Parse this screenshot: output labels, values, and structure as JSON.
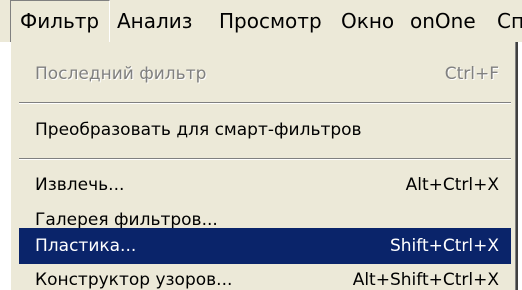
{
  "menubar": {
    "items": [
      {
        "label": "Фильтр"
      },
      {
        "label": "Анализ"
      },
      {
        "label": "Просмотр"
      },
      {
        "label": "Окно"
      },
      {
        "label": "onOne"
      },
      {
        "label": "Спр"
      }
    ],
    "active_index": 0
  },
  "dropdown": {
    "items": [
      {
        "label": "Последний фильтр",
        "shortcut": "Ctrl+F",
        "enabled": false
      },
      {
        "label": "Преобразовать для смарт-фильтров",
        "shortcut": "",
        "enabled": true
      },
      {
        "label": "Извлечь...",
        "shortcut": "Alt+Ctrl+X",
        "enabled": true
      },
      {
        "label": "Галерея фильтров...",
        "shortcut": "",
        "enabled": true
      },
      {
        "label": "Пластика...",
        "shortcut": "Shift+Ctrl+X",
        "enabled": true,
        "highlighted": true
      },
      {
        "label": "Конструктор узоров...",
        "shortcut": "Alt+Shift+Ctrl+X",
        "enabled": true
      }
    ]
  },
  "colors": {
    "menu_background": "#ece9d8",
    "highlight_background": "#0a246a",
    "highlight_text": "#ffffff",
    "disabled_text": "#808080"
  }
}
